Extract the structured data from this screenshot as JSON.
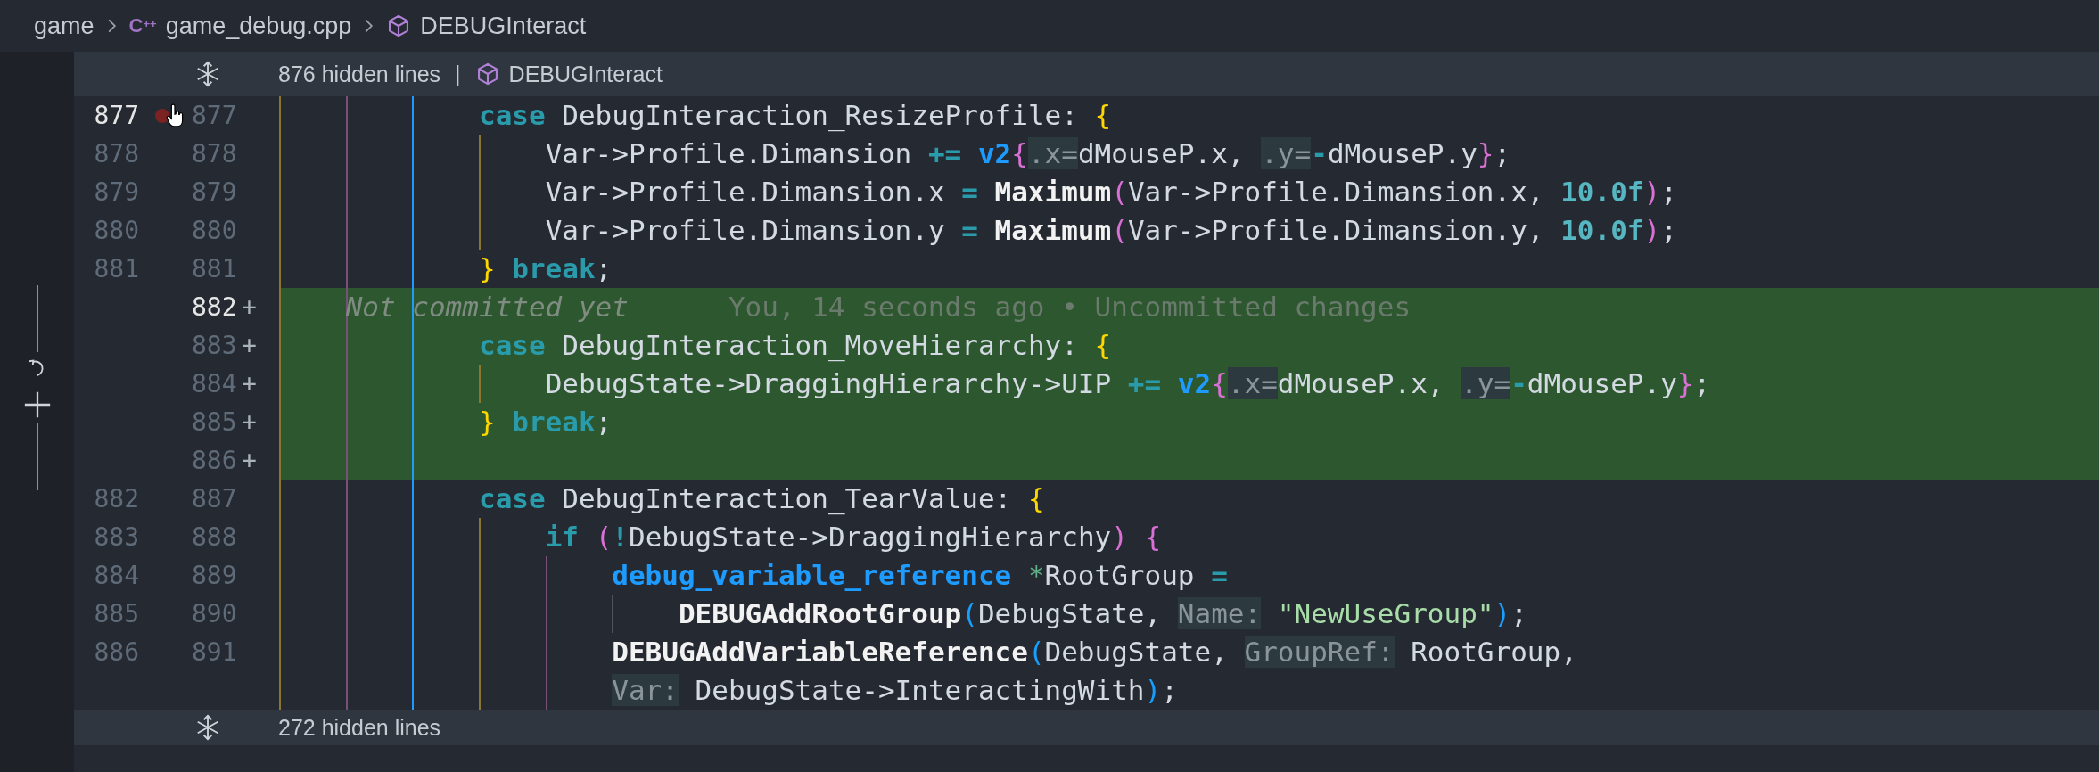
{
  "breadcrumb": [
    {
      "kind": "folder",
      "label": "game"
    },
    {
      "kind": "file",
      "icon_text": "C$^{++}$",
      "label": "game_debug.cpp"
    },
    {
      "kind": "symbol",
      "label": "DEBUGInteract"
    }
  ],
  "top_fold": {
    "label": "876 hidden lines",
    "separator": "|",
    "symbol": "DEBUGInteract"
  },
  "rows": [
    {
      "old": "877",
      "new": "877",
      "old_active": true,
      "new_active": false,
      "added": false,
      "breakpoint_hint": true,
      "tokens": [
        {
          "text": "            case",
          "color": "#2a9bab",
          "bold": true,
          "kind": "code"
        },
        {
          "text": " DebugInteraction_ResizeProfile: ",
          "color": "#d4dae3",
          "bold": false,
          "kind": "code"
        },
        {
          "text": "{",
          "color": "#ffd700",
          "bold": false,
          "kind": "code"
        }
      ]
    },
    {
      "old": "878",
      "new": "878",
      "old_active": false,
      "new_active": false,
      "added": false,
      "breakpoint_hint": false,
      "tokens": [
        {
          "text": "                Var->Profile.Dimansion ",
          "color": "#d4dae3",
          "bold": false,
          "kind": "code"
        },
        {
          "text": "+= ",
          "color": "#2a9bab",
          "bold": true,
          "kind": "code"
        },
        {
          "text": "v2",
          "color": "#1e9bff",
          "bold": true,
          "kind": "code"
        },
        {
          "text": "{",
          "color": "#da70d6",
          "bold": false,
          "kind": "code"
        },
        {
          "text": ".x=",
          "color": "#8b949c",
          "bold": false,
          "kind": "hint"
        },
        {
          "text": "dMouseP.x, ",
          "color": "#d4dae3",
          "bold": false,
          "kind": "code"
        },
        {
          "text": ".y=",
          "color": "#8b949c",
          "bold": false,
          "kind": "hint"
        },
        {
          "text": "-",
          "color": "#2a9bab",
          "bold": true,
          "kind": "code"
        },
        {
          "text": "dMouseP.y",
          "color": "#d4dae3",
          "bold": false,
          "kind": "code"
        },
        {
          "text": "}",
          "color": "#da70d6",
          "bold": false,
          "kind": "code"
        },
        {
          "text": ";",
          "color": "#d4dae3",
          "bold": false,
          "kind": "code"
        }
      ]
    },
    {
      "old": "879",
      "new": "879",
      "old_active": false,
      "new_active": false,
      "added": false,
      "breakpoint_hint": false,
      "tokens": [
        {
          "text": "                Var->Profile.Dimansion.x ",
          "color": "#d4dae3",
          "bold": false,
          "kind": "code"
        },
        {
          "text": "= ",
          "color": "#2a9bab",
          "bold": true,
          "kind": "code"
        },
        {
          "text": "Maximum",
          "color": "#f2f2f2",
          "bold": true,
          "kind": "code"
        },
        {
          "text": "(",
          "color": "#da70d6",
          "bold": false,
          "kind": "code"
        },
        {
          "text": "Var->Profile.Dimansion.x, ",
          "color": "#d4dae3",
          "bold": false,
          "kind": "code"
        },
        {
          "text": "10.0f",
          "color": "#56b6c2",
          "bold": true,
          "kind": "code"
        },
        {
          "text": ")",
          "color": "#da70d6",
          "bold": false,
          "kind": "code"
        },
        {
          "text": ";",
          "color": "#d4dae3",
          "bold": false,
          "kind": "code"
        }
      ]
    },
    {
      "old": "880",
      "new": "880",
      "old_active": false,
      "new_active": false,
      "added": false,
      "breakpoint_hint": false,
      "tokens": [
        {
          "text": "                Var->Profile.Dimansion.y ",
          "color": "#d4dae3",
          "bold": false,
          "kind": "code"
        },
        {
          "text": "= ",
          "color": "#2a9bab",
          "bold": true,
          "kind": "code"
        },
        {
          "text": "Maximum",
          "color": "#f2f2f2",
          "bold": true,
          "kind": "code"
        },
        {
          "text": "(",
          "color": "#da70d6",
          "bold": false,
          "kind": "code"
        },
        {
          "text": "Var->Profile.Dimansion.y, ",
          "color": "#d4dae3",
          "bold": false,
          "kind": "code"
        },
        {
          "text": "10.0f",
          "color": "#56b6c2",
          "bold": true,
          "kind": "code"
        },
        {
          "text": ")",
          "color": "#da70d6",
          "bold": false,
          "kind": "code"
        },
        {
          "text": ";",
          "color": "#d4dae3",
          "bold": false,
          "kind": "code"
        }
      ]
    },
    {
      "old": "881",
      "new": "881",
      "old_active": false,
      "new_active": false,
      "added": false,
      "breakpoint_hint": false,
      "tokens": [
        {
          "text": "            } ",
          "color": "#ffd700",
          "bold": false,
          "kind": "code"
        },
        {
          "text": "break",
          "color": "#2a9bab",
          "bold": true,
          "kind": "code"
        },
        {
          "text": ";",
          "color": "#d4dae3",
          "bold": false,
          "kind": "code"
        }
      ]
    },
    {
      "new": "882",
      "marker": "+",
      "old_active": false,
      "new_active": true,
      "added": true,
      "breakpoint_hint": false,
      "blame": {
        "author": "Not committed yet",
        "detail": "You, 14 seconds ago • Uncommitted changes"
      }
    },
    {
      "new": "883",
      "marker": "+",
      "old_active": false,
      "new_active": false,
      "added": true,
      "breakpoint_hint": false,
      "tokens": [
        {
          "text": "            case",
          "color": "#2a9bab",
          "bold": true,
          "kind": "code"
        },
        {
          "text": " DebugInteraction_MoveHierarchy: ",
          "color": "#d4dae3",
          "bold": false,
          "kind": "code"
        },
        {
          "text": "{",
          "color": "#ffd700",
          "bold": false,
          "kind": "code"
        }
      ]
    },
    {
      "new": "884",
      "marker": "+",
      "old_active": false,
      "new_active": false,
      "added": true,
      "breakpoint_hint": false,
      "tokens": [
        {
          "text": "                DebugState->DraggingHierarchy->UIP ",
          "color": "#d4dae3",
          "bold": false,
          "kind": "code"
        },
        {
          "text": "+= ",
          "color": "#2a9bab",
          "bold": true,
          "kind": "code"
        },
        {
          "text": "v2",
          "color": "#1e9bff",
          "bold": true,
          "kind": "code"
        },
        {
          "text": "{",
          "color": "#da70d6",
          "bold": false,
          "kind": "code"
        },
        {
          "text": ".x=",
          "color": "#8b949c",
          "bold": false,
          "kind": "hint"
        },
        {
          "text": "dMouseP.x, ",
          "color": "#d4dae3",
          "bold": false,
          "kind": "code"
        },
        {
          "text": ".y=",
          "color": "#8b949c",
          "bold": false,
          "kind": "hint"
        },
        {
          "text": "-",
          "color": "#2a9bab",
          "bold": true,
          "kind": "code"
        },
        {
          "text": "dMouseP.y",
          "color": "#d4dae3",
          "bold": false,
          "kind": "code"
        },
        {
          "text": "}",
          "color": "#da70d6",
          "bold": false,
          "kind": "code"
        },
        {
          "text": ";",
          "color": "#d4dae3",
          "bold": false,
          "kind": "code"
        }
      ]
    },
    {
      "new": "885",
      "marker": "+",
      "old_active": false,
      "new_active": false,
      "added": true,
      "breakpoint_hint": false,
      "tokens": [
        {
          "text": "            } ",
          "color": "#ffd700",
          "bold": false,
          "kind": "code"
        },
        {
          "text": "break",
          "color": "#2a9bab",
          "bold": true,
          "kind": "code"
        },
        {
          "text": ";",
          "color": "#d4dae3",
          "bold": false,
          "kind": "code"
        }
      ]
    },
    {
      "new": "886",
      "marker": "+",
      "old_active": false,
      "new_active": false,
      "added": true,
      "breakpoint_hint": false
    },
    {
      "old": "882",
      "new": "887",
      "old_active": false,
      "new_active": false,
      "added": false,
      "breakpoint_hint": false,
      "tokens": [
        {
          "text": "            case",
          "color": "#2a9bab",
          "bold": true,
          "kind": "code"
        },
        {
          "text": " DebugInteraction_TearValue: ",
          "color": "#d4dae3",
          "bold": false,
          "kind": "code"
        },
        {
          "text": "{",
          "color": "#ffd700",
          "bold": false,
          "kind": "code"
        }
      ]
    },
    {
      "old": "883",
      "new": "888",
      "old_active": false,
      "new_active": false,
      "added": false,
      "breakpoint_hint": false,
      "tokens": [
        {
          "text": "                if ",
          "color": "#2a9bab",
          "bold": true,
          "kind": "code"
        },
        {
          "text": "(",
          "color": "#da70d6",
          "bold": false,
          "kind": "code"
        },
        {
          "text": "!",
          "color": "#2a9bab",
          "bold": true,
          "kind": "code"
        },
        {
          "text": "DebugState->DraggingHierarchy",
          "color": "#d4dae3",
          "bold": false,
          "kind": "code"
        },
        {
          "text": ") {",
          "color": "#da70d6",
          "bold": false,
          "kind": "code"
        }
      ]
    },
    {
      "old": "884",
      "new": "889",
      "old_active": false,
      "new_active": false,
      "added": false,
      "breakpoint_hint": false,
      "tokens": [
        {
          "text": "                    debug_variable_reference ",
          "color": "#1e9bff",
          "bold": true,
          "kind": "code"
        },
        {
          "text": "*",
          "color": "#5faf87",
          "bold": false,
          "kind": "code"
        },
        {
          "text": "RootGroup ",
          "color": "#d4dae3",
          "bold": false,
          "kind": "code"
        },
        {
          "text": "=",
          "color": "#2a9bab",
          "bold": true,
          "kind": "code"
        }
      ]
    },
    {
      "old": "885",
      "new": "890",
      "old_active": false,
      "new_active": false,
      "added": false,
      "breakpoint_hint": false,
      "tokens": [
        {
          "text": "                        DEBUGAddRootGroup",
          "color": "#f2f2f2",
          "bold": true,
          "kind": "code"
        },
        {
          "text": "(",
          "color": "#179fff",
          "bold": false,
          "kind": "code"
        },
        {
          "text": "DebugState, ",
          "color": "#d4dae3",
          "bold": false,
          "kind": "code"
        },
        {
          "text": "Name:",
          "color": "#8b949c",
          "bold": false,
          "kind": "hint"
        },
        {
          "text": " \"NewUseGroup\"",
          "color": "#a8dca8",
          "bold": false,
          "kind": "code"
        },
        {
          "text": ")",
          "color": "#179fff",
          "bold": false,
          "kind": "code"
        },
        {
          "text": ";",
          "color": "#d4dae3",
          "bold": false,
          "kind": "code"
        }
      ]
    },
    {
      "old": "886",
      "new": "891",
      "old_active": false,
      "new_active": false,
      "added": false,
      "breakpoint_hint": false,
      "tokens": [
        {
          "text": "                    DEBUGAddVariableReference",
          "color": "#f2f2f2",
          "bold": true,
          "kind": "code"
        },
        {
          "text": "(",
          "color": "#179fff",
          "bold": false,
          "kind": "code"
        },
        {
          "text": "DebugState, ",
          "color": "#d4dae3",
          "bold": false,
          "kind": "code"
        },
        {
          "text": "GroupRef:",
          "color": "#8b949c",
          "bold": false,
          "kind": "hint"
        },
        {
          "text": " RootGroup,",
          "color": "#d4dae3",
          "bold": false,
          "kind": "code"
        }
      ]
    },
    {
      "added": false,
      "breakpoint_hint": false,
      "tokens": [
        {
          "text": "                    Var:",
          "color": "#8b949c",
          "bold": false,
          "kind": "hint"
        },
        {
          "text": " DebugState->InteractingWith",
          "color": "#d4dae3",
          "bold": false,
          "kind": "code"
        },
        {
          "text": ")",
          "color": "#179fff",
          "bold": false,
          "kind": "code"
        },
        {
          "text": ";",
          "color": "#d4dae3",
          "bold": false,
          "kind": "code"
        }
      ]
    }
  ],
  "bottom_fold": {
    "label": "272 hidden lines"
  }
}
